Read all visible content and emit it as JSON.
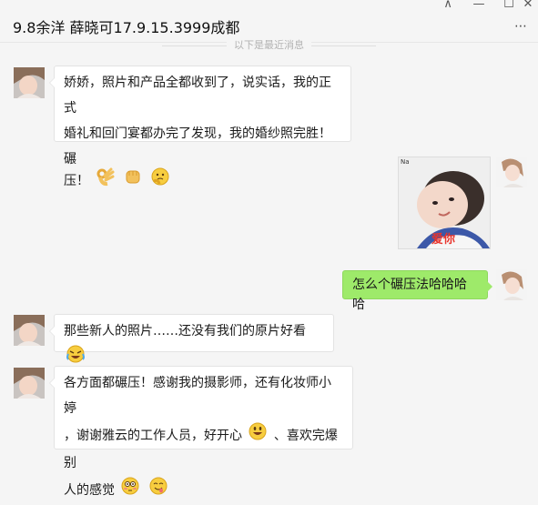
{
  "window": {
    "title": "9.8余洋 薛晓可17.9.15.3999成都",
    "more_label": "⋯",
    "buttons": {
      "pin": "⊼",
      "minimize": "—",
      "maximize": "☐",
      "close": "✕"
    }
  },
  "history_separator": "以下是最近消息",
  "messages": [
    {
      "side": "left",
      "type": "text",
      "text_line1": "娇娇，照片和产品全都收到了，说实话，我的正式",
      "text_line2": "婚礼和回门宴都办完了发现，我的婚纱照完胜！碾",
      "text_line3": "压！",
      "emojis": [
        "ok-hand-icon",
        "fist-icon",
        "thinking-face-icon"
      ]
    },
    {
      "side": "right",
      "type": "image",
      "image_caption": "爱你",
      "image_tag": "Na"
    },
    {
      "side": "right",
      "type": "text",
      "text": "怎么个碾压法哈哈哈哈"
    },
    {
      "side": "left",
      "type": "text",
      "text": "那些新人的照片……还没有我们的原片好看",
      "emojis": [
        "laughing-tears-icon"
      ]
    },
    {
      "side": "left",
      "type": "text",
      "text_line1": "各方面都碾压！感谢我的摄影师，还有化妆师小婷",
      "text_line2a": "，谢谢雅云的工作人员，好开心",
      "text_line2b": "、喜欢完爆别",
      "text_line3": "人的感觉",
      "emojis": [
        "grin-icon",
        "flushed-face-icon",
        "yum-face-icon"
      ]
    }
  ],
  "colors": {
    "sent_bubble": "#9eea6a",
    "received_bubble": "#ffffff",
    "background": "#f5f5f5"
  }
}
